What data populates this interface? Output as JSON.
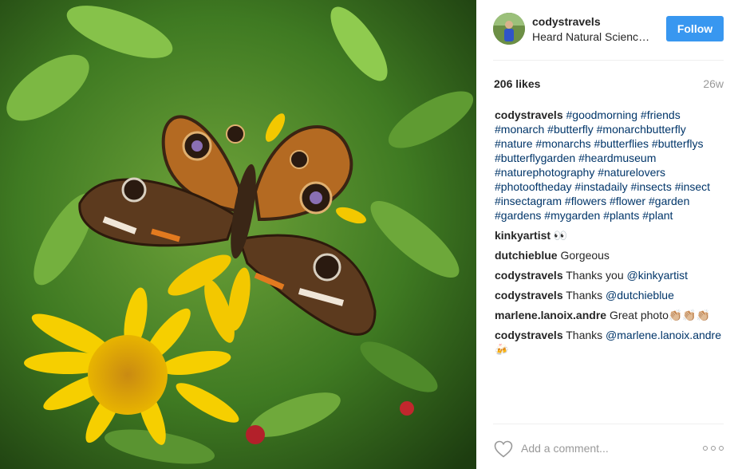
{
  "post": {
    "author": "codystravels",
    "location": "Heard Natural Science Museum",
    "follow_label": "Follow",
    "likes": "206 likes",
    "age": "26w"
  },
  "caption": {
    "user": "codystravels",
    "tags": [
      " #goodmorning",
      " #friends",
      " #monarch",
      " #butterfly",
      " #monarchbutterfly",
      " #nature",
      " #monarchs",
      " #butterflies",
      " #butterflys",
      " #butterflygarden",
      " #heardmuseum",
      " #naturephotography",
      " #naturelovers",
      " #photooftheday",
      " #instadaily",
      " #insects",
      " #insect",
      " #insectagram",
      " #flowers",
      " #flower",
      " #garden",
      " #gardens",
      " #mygarden",
      " #plants",
      " #plant"
    ]
  },
  "comments": [
    {
      "user": "kinkyartist",
      "text": " 👀"
    },
    {
      "user": "dutchieblue",
      "text": " Gorgeous"
    },
    {
      "user": "codystravels",
      "text": " Thanks you ",
      "mention": "@kinkyartist"
    },
    {
      "user": "codystravels",
      "text": " Thanks ",
      "mention": "@dutchieblue"
    },
    {
      "user": "marlene.lanoix.andre",
      "text": " Great photo👏🏼👏🏼👏🏼"
    },
    {
      "user": "codystravels",
      "text": " Thanks ",
      "mention": "@marlene.lanoix.andre",
      "suffix": " 🍻"
    }
  ],
  "footer": {
    "comment_placeholder": "Add a comment..."
  },
  "icons": {
    "like": "heart-icon",
    "more": "more-options-icon"
  },
  "colors": {
    "follow_button": "#3897f0",
    "link": "#003569",
    "muted": "#999999"
  }
}
